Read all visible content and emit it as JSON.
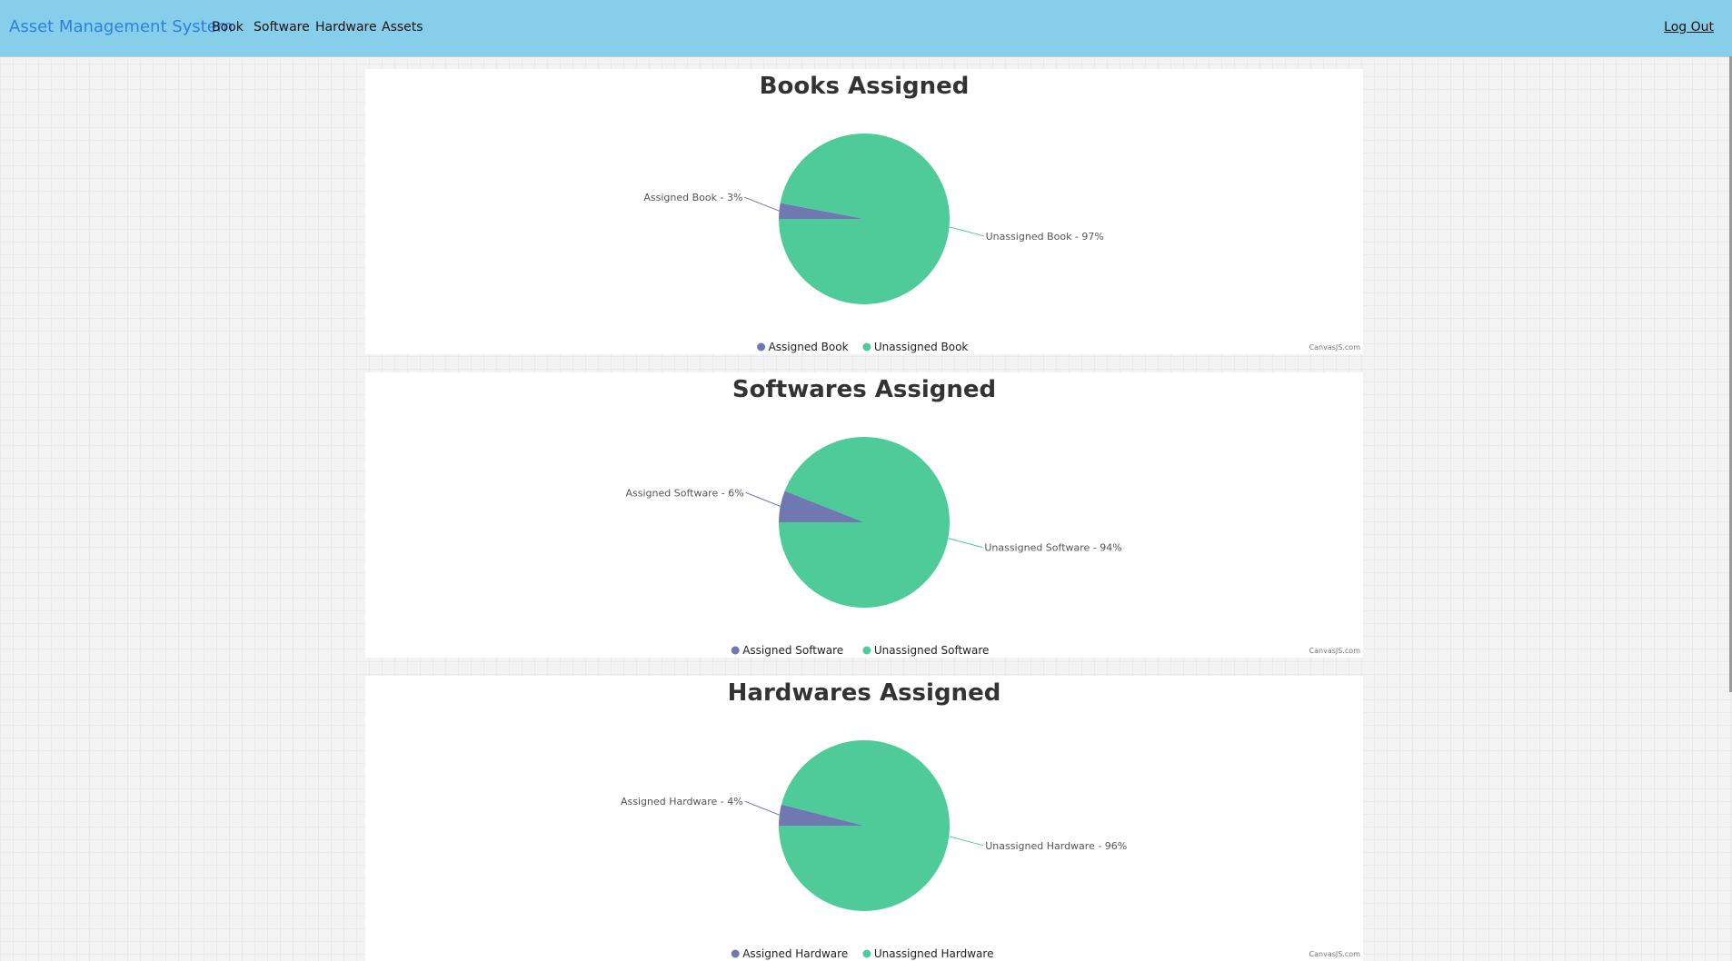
{
  "nav": {
    "brand": "Asset Management System",
    "items": [
      "Book",
      "Software",
      "Hardware",
      "Assets"
    ],
    "logout": "Log Out"
  },
  "colors": {
    "navbar": "#87ceeb",
    "brand": "#2f7fe0",
    "assigned": "#6f78b1",
    "unassigned": "#4fcb9a"
  },
  "chart_data": [
    {
      "type": "pie",
      "title": "Books Assigned",
      "slices": [
        {
          "name": "Assigned Book",
          "value": 3,
          "label": "Assigned Book - 3%"
        },
        {
          "name": "Unassigned Book",
          "value": 97,
          "label": "Unassigned Book - 97%"
        }
      ],
      "legend": [
        "Assigned Book",
        "Unassigned Book"
      ],
      "legend_placement": "bottom",
      "credit": "CanvasJS.com"
    },
    {
      "type": "pie",
      "title": "Softwares Assigned",
      "slices": [
        {
          "name": "Assigned Software",
          "value": 6,
          "label": "Assigned Software - 6%"
        },
        {
          "name": "Unassigned Software",
          "value": 94,
          "label": "Unassigned Software - 94%"
        }
      ],
      "legend": [
        "Assigned Software",
        "Unassigned Software"
      ],
      "legend_placement": "bottom",
      "credit": "CanvasJS.com"
    },
    {
      "type": "pie",
      "title": "Hardwares Assigned",
      "slices": [
        {
          "name": "Assigned Hardware",
          "value": 4,
          "label": "Assigned Hardware - 4%"
        },
        {
          "name": "Unassigned Hardware",
          "value": 96,
          "label": "Unassigned Hardware - 96%"
        }
      ],
      "legend": [
        "Assigned Hardware",
        "Unassigned Hardware"
      ],
      "legend_placement": "bottom",
      "credit": "CanvasJS.com"
    }
  ]
}
